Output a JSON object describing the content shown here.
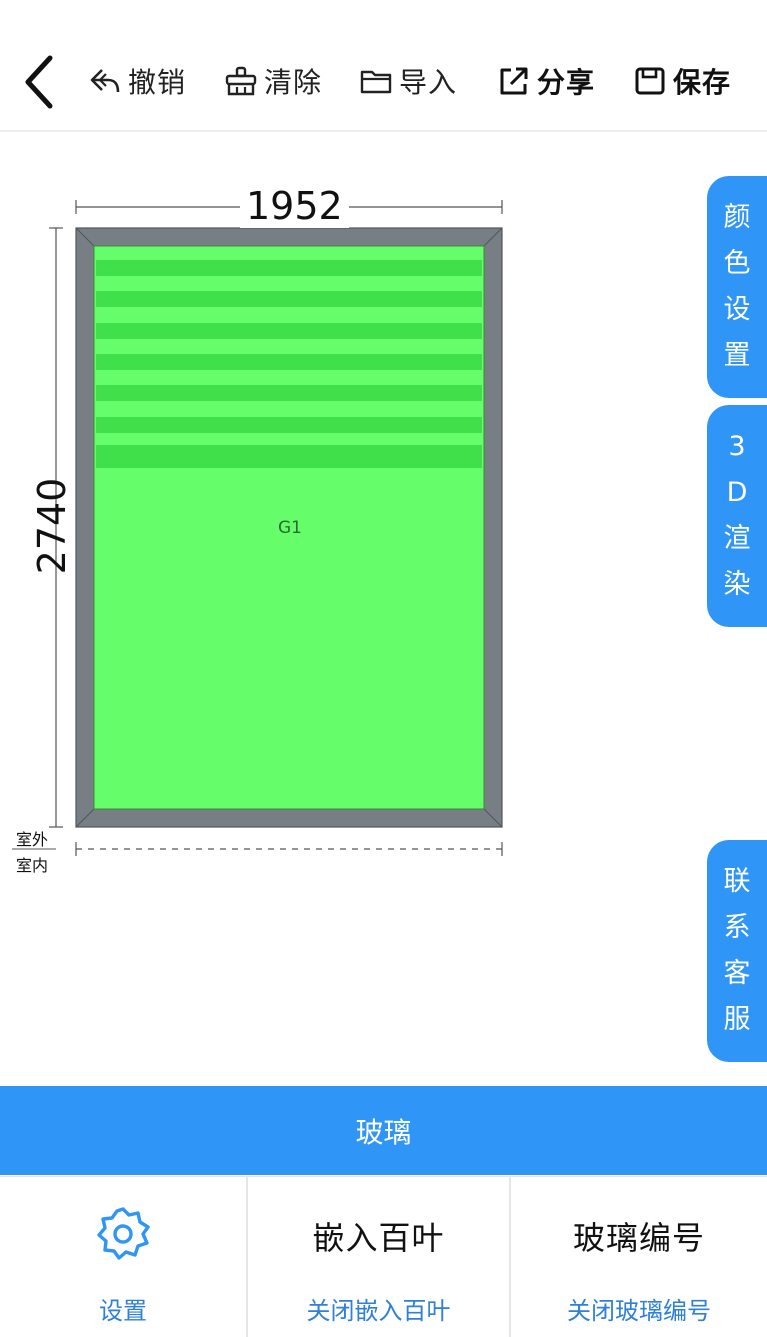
{
  "toolbar": {
    "undo_label": "撤销",
    "clear_label": "清除",
    "import_label": "导入",
    "share_label": "分享",
    "save_label": "保存"
  },
  "canvas": {
    "width_dim": "1952",
    "height_dim": "2740",
    "glass_id": "G1",
    "outside_label": "室外",
    "inside_label": "室内",
    "frame_color": "#777f85",
    "glass_color": "#66fd6a",
    "louver_color": "#3fe049"
  },
  "side_tabs": {
    "color_settings": [
      "颜",
      "色",
      "设",
      "置"
    ],
    "render_3d": [
      "3",
      "D",
      "渲",
      "染"
    ],
    "contact": [
      "联",
      "系",
      "客",
      "服"
    ]
  },
  "glass_bar": {
    "label": "玻璃"
  },
  "bottom_panel": {
    "settings_label": "设置",
    "louver_label": "嵌入百叶",
    "louver_action": "关闭嵌入百叶",
    "glass_no_label": "玻璃编号",
    "glass_no_action": "关闭玻璃编号"
  },
  "colors": {
    "accent": "#2f95f6",
    "link": "#2f80d8"
  }
}
